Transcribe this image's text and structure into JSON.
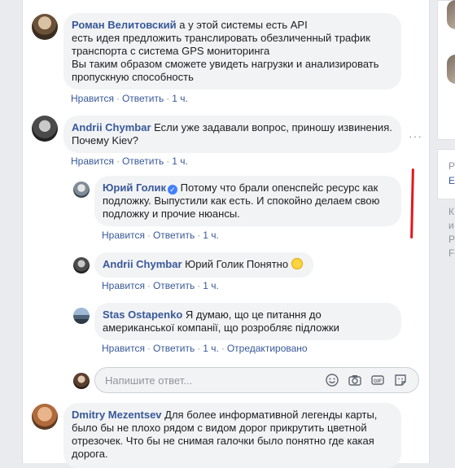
{
  "comments": [
    {
      "author": "Роман Велитовский",
      "lines": [
        "а у этой системы есть API",
        "есть идея предложить транслировать обезличенный трафик",
        "транспорта с система GPS мониторинга",
        "Вы таким образом сможете увидеть нагрузки и анализировать",
        "пропускную способность"
      ],
      "like": "Нравится",
      "reply": "Ответить",
      "time": "1 ч."
    },
    {
      "author": "Andrii Chymbar",
      "lines": [
        "Если уже задавали вопрос, приношу извинения.",
        "Почему Kiev?"
      ],
      "like": "Нравится",
      "reply": "Ответить",
      "time": "1 ч."
    },
    {
      "author": "Юрий Голик",
      "lines": [
        "Потому что брали опенспейс ресурс как",
        "подложку. Выпустили как есть. И спокойно делаем свою",
        "подложку и прочие нюансы."
      ],
      "like": "Нравится",
      "reply": "Ответить",
      "time": "1 ч."
    },
    {
      "author": "Andrii Chymbar",
      "lines": [
        "Юрий Голик Понятно"
      ],
      "like": "Нравится",
      "reply": "Ответить",
      "time": "1 ч."
    },
    {
      "author": "Stas Ostapenko",
      "lines": [
        "Я думаю, що це питання до",
        "американської компанії, що розробляє підложки"
      ],
      "like": "Нравится",
      "reply": "Ответить",
      "time": "1 ч.",
      "edited": "Отредактировано"
    },
    {
      "author": "Dmitry Mezentsev",
      "lines": [
        "Для более информативной легенды карты,",
        "было бы не плохо рядом с видом дорог прикрутить цветной",
        "отрезочек. Что бы не снимая галочки было понятно где какая",
        "дорога."
      ]
    }
  ],
  "reply_box": {
    "placeholder": "Напишите ответ..."
  },
  "icons": [
    "emoji-icon",
    "camera-icon",
    "gif-icon",
    "sticker-icon",
    "verified-badge-icon",
    "more-options-icon"
  ],
  "right_column": {
    "frag1": "Р",
    "frag2": "E",
    "frag3": "К",
    "frag4": "и",
    "frag5": "Р",
    "frag6": "F"
  },
  "colors": {
    "link": "#385898",
    "meta": "#90949c",
    "bubble": "#f2f3f5",
    "annotation": "#e4161b"
  }
}
